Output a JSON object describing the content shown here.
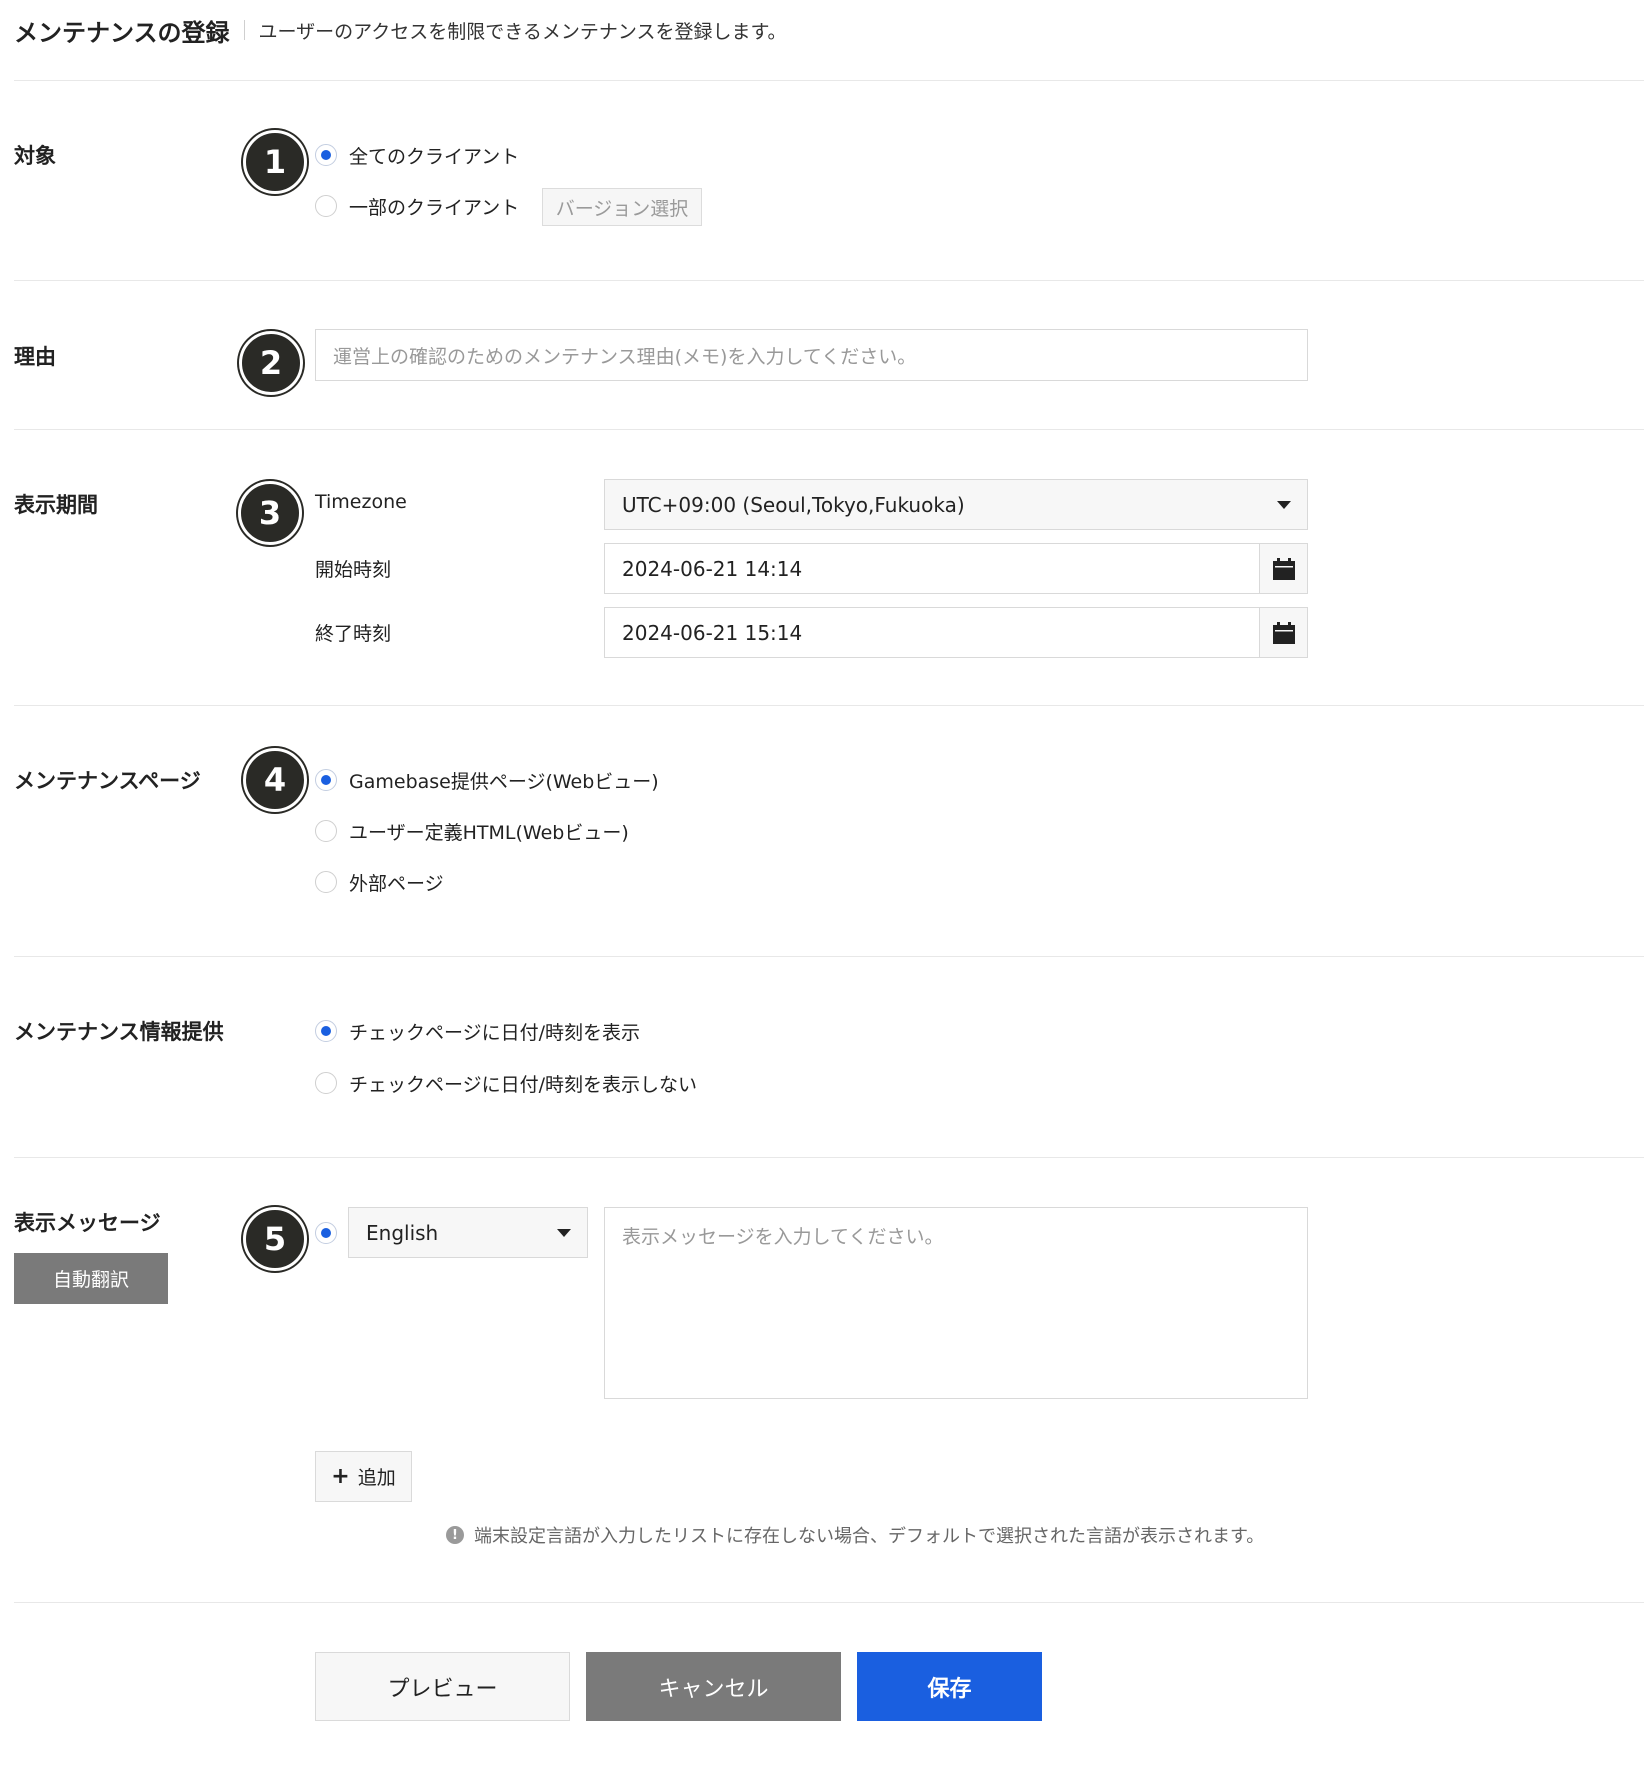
{
  "header": {
    "title": "メンテナンスの登録",
    "description": "ユーザーのアクセスを制限できるメンテナンスを登録します。"
  },
  "target": {
    "label": "対象",
    "badge": "1",
    "options": [
      {
        "label": "全てのクライアント",
        "checked": true
      },
      {
        "label": "一部のクライアント",
        "checked": false
      }
    ],
    "version_button": "バージョン選択"
  },
  "reason": {
    "label": "理由",
    "badge": "2",
    "placeholder": "運営上の確認のためのメンテナンス理由(メモ)を入力してください。"
  },
  "period": {
    "label": "表示期間",
    "badge": "3",
    "timezone_label": "Timezone",
    "timezone_value": "UTC+09:00 (Seoul,Tokyo,Fukuoka)",
    "start_label": "開始時刻",
    "start_value": "2024-06-21 14:14",
    "end_label": "終了時刻",
    "end_value": "2024-06-21 15:14"
  },
  "page": {
    "label": "メンテナンスページ",
    "badge": "4",
    "options": [
      {
        "label": "Gamebase提供ページ(Webビュー)",
        "checked": true
      },
      {
        "label": "ユーザー定義HTML(Webビュー)",
        "checked": false
      },
      {
        "label": "外部ページ",
        "checked": false
      }
    ]
  },
  "info": {
    "label": "メンテナンス情報提供",
    "options": [
      {
        "label": "チェックページに日付/時刻を表示",
        "checked": true
      },
      {
        "label": "チェックページに日付/時刻を表示しない",
        "checked": false
      }
    ]
  },
  "message": {
    "label": "表示メッセージ",
    "badge": "5",
    "auto_translate": "自動翻訳",
    "language": "English",
    "placeholder": "表示メッセージを入力してください。",
    "add_button": "追加",
    "notice": "端末設定言語が入力したリストに存在しない場合、デフォルトで選択された言語が表示されます。"
  },
  "actions": {
    "preview": "プレビュー",
    "cancel": "キャンセル",
    "save": "保存"
  },
  "colors": {
    "accent": "#1a5fe0",
    "gray_button": "#7a7a7a",
    "badge": "#2a2a26"
  },
  "icons": [
    "calendar-icon",
    "caret-down-icon",
    "plus-icon",
    "info-icon"
  ]
}
